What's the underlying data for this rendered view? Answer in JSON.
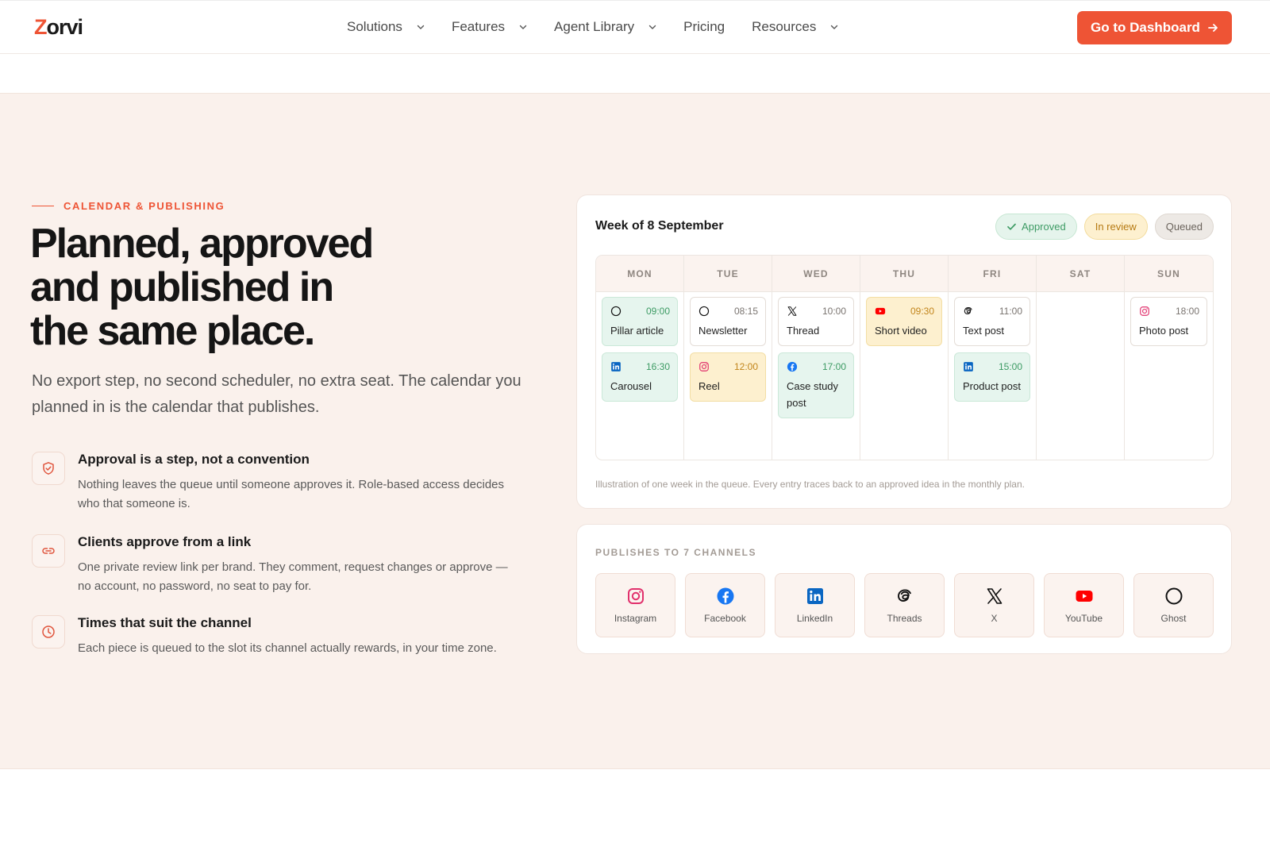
{
  "nav": {
    "logo_first": "Z",
    "logo_rest": "orvi",
    "items": [
      {
        "label": "Solutions",
        "dropdown": true
      },
      {
        "label": "Features",
        "dropdown": true
      },
      {
        "label": "Agent Library",
        "dropdown": true
      },
      {
        "label": "Pricing",
        "dropdown": false
      },
      {
        "label": "Resources",
        "dropdown": true
      }
    ],
    "cta_label": "Go to Dashboard"
  },
  "hero": {
    "eyebrow": "CALENDAR & PUBLISHING",
    "headline_1": "Planned, approved",
    "headline_2": "and published in",
    "headline_3": "the same place.",
    "lead": "No export step, no second scheduler, no extra seat. The calendar you planned in is the calendar that publishes."
  },
  "features": [
    {
      "icon": "shield-check-icon",
      "title": "Approval is a step, not a convention",
      "desc": "Nothing leaves the queue until someone approves it. Role-based access decides who that someone is."
    },
    {
      "icon": "link-icon",
      "title": "Clients approve from a link",
      "desc": "One private review link per brand. They comment, request changes or approve — no account, no password, no seat to pay for."
    },
    {
      "icon": "clock-icon",
      "title": "Times that suit the channel",
      "desc": "Each piece is queued to the slot its channel actually rewards, in your time zone."
    }
  ],
  "calendar": {
    "title": "Week of 8 September",
    "legend": {
      "approved": "Approved",
      "review": "In review",
      "queued": "Queued"
    },
    "days": [
      {
        "label": "MON",
        "entries": [
          {
            "channel": "ghost",
            "time": "09:00",
            "name": "Pillar article",
            "status": "approved"
          },
          {
            "channel": "linkedin",
            "time": "16:30",
            "name": "Carousel",
            "status": "approved"
          }
        ]
      },
      {
        "label": "TUE",
        "entries": [
          {
            "channel": "ghost",
            "time": "08:15",
            "name": "Newsletter",
            "status": "queued"
          },
          {
            "channel": "instagram",
            "time": "12:00",
            "name": "Reel",
            "status": "review"
          }
        ]
      },
      {
        "label": "WED",
        "entries": [
          {
            "channel": "x",
            "time": "10:00",
            "name": "Thread",
            "status": "queued"
          },
          {
            "channel": "facebook",
            "time": "17:00",
            "name": "Case study post",
            "status": "approved"
          }
        ]
      },
      {
        "label": "THU",
        "entries": [
          {
            "channel": "youtube",
            "time": "09:30",
            "name": "Short video",
            "status": "review"
          }
        ]
      },
      {
        "label": "FRI",
        "entries": [
          {
            "channel": "threads",
            "time": "11:00",
            "name": "Text post",
            "status": "queued"
          },
          {
            "channel": "linkedin",
            "time": "15:00",
            "name": "Product post",
            "status": "approved"
          }
        ]
      },
      {
        "label": "SAT",
        "entries": []
      },
      {
        "label": "SUN",
        "entries": [
          {
            "channel": "instagram",
            "time": "18:00",
            "name": "Photo post",
            "status": "queued"
          }
        ]
      }
    ],
    "note": "Illustration of one week in the queue. Every entry traces back to an approved idea in the monthly plan."
  },
  "channels": {
    "label": "PUBLISHES TO 7 CHANNELS",
    "items": [
      {
        "key": "instagram",
        "name": "Instagram"
      },
      {
        "key": "facebook",
        "name": "Facebook"
      },
      {
        "key": "linkedin",
        "name": "LinkedIn"
      },
      {
        "key": "threads",
        "name": "Threads"
      },
      {
        "key": "x",
        "name": "X"
      },
      {
        "key": "youtube",
        "name": "YouTube"
      },
      {
        "key": "ghost",
        "name": "Ghost"
      }
    ]
  },
  "colors": {
    "accent": "#ee5435",
    "section_bg": "#faf1ec",
    "approved": "#3d9b64",
    "review": "#c2851b",
    "queued": "#6a635c",
    "instagram": "#e1306c",
    "facebook": "#1877f2",
    "linkedin": "#0a66c2",
    "youtube": "#ff0000"
  }
}
